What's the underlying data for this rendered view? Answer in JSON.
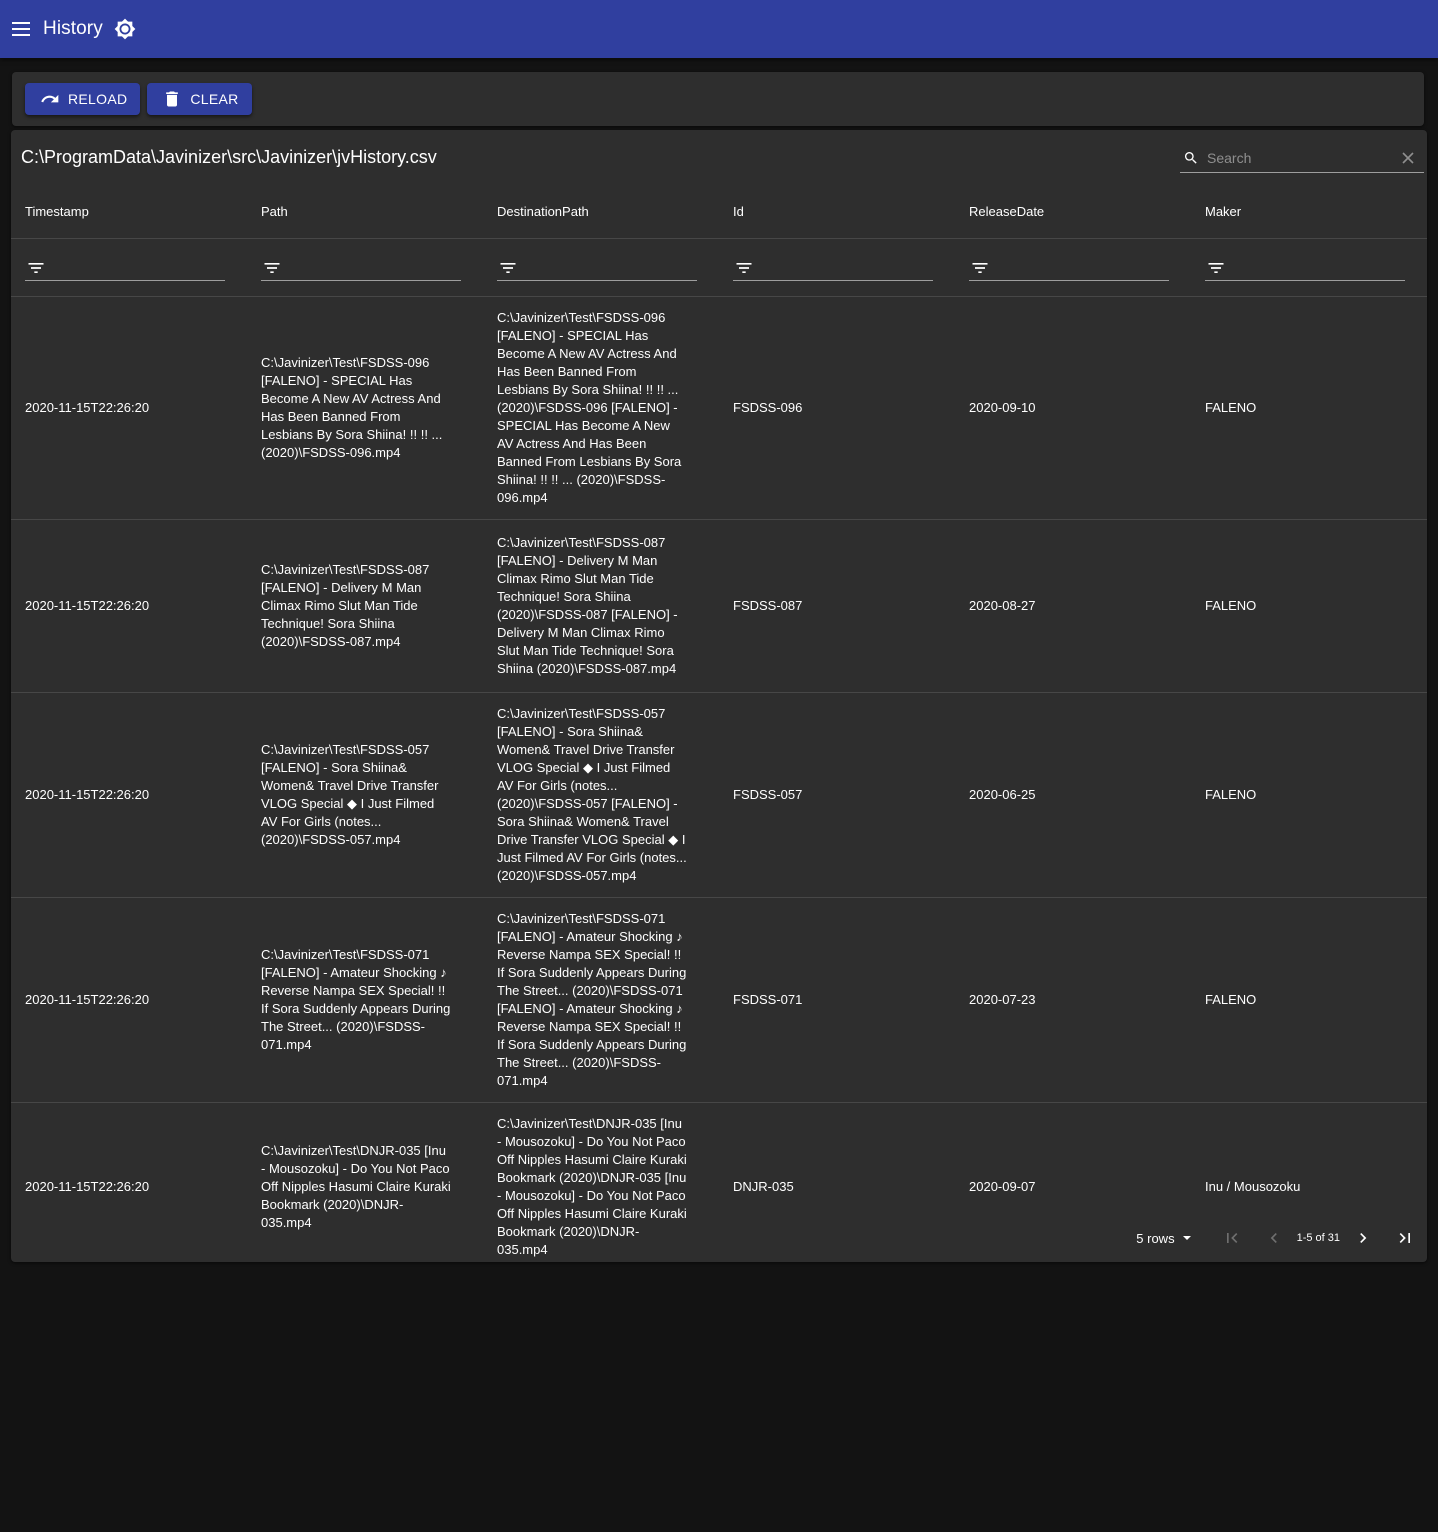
{
  "appbar": {
    "title": "History",
    "menu_icon": "menu-icon",
    "theme_icon": "brightness-icon"
  },
  "toolbar": {
    "reload_label": "RELOAD",
    "clear_label": "CLEAR"
  },
  "table": {
    "title": "C:\\ProgramData\\Javinizer\\src\\Javinizer\\jvHistory.csv",
    "search_placeholder": "Search",
    "columns": [
      "Timestamp",
      "Path",
      "DestinationPath",
      "Id",
      "ReleaseDate",
      "Maker"
    ],
    "rows": [
      {
        "timestamp": "2020-11-15T22:26:20",
        "path": "C:\\Javinizer\\Test\\FSDSS-096 [FALENO] - SPECIAL Has Become A New AV Actress And Has Been Banned From Lesbians By Sora Shiina! !! !! ... (2020)\\FSDSS-096.mp4",
        "destination": "C:\\Javinizer\\Test\\FSDSS-096 [FALENO] - SPECIAL Has Become A New AV Actress And Has Been Banned From Lesbians By Sora Shiina! !! !! ... (2020)\\FSDSS-096 [FALENO] - SPECIAL Has Become A New AV Actress And Has Been Banned From Lesbians By Sora Shiina! !! !! ... (2020)\\FSDSS-096.mp4",
        "id": "FSDSS-096",
        "release_date": "2020-09-10",
        "maker": "FALENO"
      },
      {
        "timestamp": "2020-11-15T22:26:20",
        "path": "C:\\Javinizer\\Test\\FSDSS-087 [FALENO] - Delivery M Man Climax Rimo Slut Man Tide Technique! Sora Shiina (2020)\\FSDSS-087.mp4",
        "destination": "C:\\Javinizer\\Test\\FSDSS-087 [FALENO] - Delivery M Man Climax Rimo Slut Man Tide Technique! Sora Shiina (2020)\\FSDSS-087 [FALENO] - Delivery M Man Climax Rimo Slut Man Tide Technique! Sora Shiina (2020)\\FSDSS-087.mp4",
        "id": "FSDSS-087",
        "release_date": "2020-08-27",
        "maker": "FALENO"
      },
      {
        "timestamp": "2020-11-15T22:26:20",
        "path": "C:\\Javinizer\\Test\\FSDSS-057 [FALENO] - Sora Shiina& Women& Travel Drive Transfer VLOG Special ◆ I Just Filmed AV For Girls (notes... (2020)\\FSDSS-057.mp4",
        "destination": "C:\\Javinizer\\Test\\FSDSS-057 [FALENO] - Sora Shiina& Women& Travel Drive Transfer VLOG Special ◆ I Just Filmed AV For Girls (notes... (2020)\\FSDSS-057 [FALENO] - Sora Shiina& Women& Travel Drive Transfer VLOG Special ◆ I Just Filmed AV For Girls (notes... (2020)\\FSDSS-057.mp4",
        "id": "FSDSS-057",
        "release_date": "2020-06-25",
        "maker": "FALENO"
      },
      {
        "timestamp": "2020-11-15T22:26:20",
        "path": "C:\\Javinizer\\Test\\FSDSS-071 [FALENO] - Amateur Shocking ♪ Reverse Nampa SEX Special! !! If Sora Suddenly Appears During The Street... (2020)\\FSDSS-071.mp4",
        "destination": "C:\\Javinizer\\Test\\FSDSS-071 [FALENO] - Amateur Shocking ♪ Reverse Nampa SEX Special! !! If Sora Suddenly Appears During The Street... (2020)\\FSDSS-071 [FALENO] - Amateur Shocking ♪ Reverse Nampa SEX Special! !! If Sora Suddenly Appears During The Street... (2020)\\FSDSS-071.mp4",
        "id": "FSDSS-071",
        "release_date": "2020-07-23",
        "maker": "FALENO"
      },
      {
        "timestamp": "2020-11-15T22:26:20",
        "path": "C:\\Javinizer\\Test\\DNJR-035 [Inu - Mousozoku] - Do You Not Paco Off Nipples Hasumi Claire Kuraki Bookmark (2020)\\DNJR-035.mp4",
        "destination": "C:\\Javinizer\\Test\\DNJR-035 [Inu - Mousozoku] - Do You Not Paco Off Nipples Hasumi Claire Kuraki Bookmark (2020)\\DNJR-035 [Inu - Mousozoku] - Do You Not Paco Off Nipples Hasumi Claire Kuraki Bookmark (2020)\\DNJR-035.mp4",
        "id": "DNJR-035",
        "release_date": "2020-09-07",
        "maker": "Inu / Mousozoku"
      }
    ]
  },
  "pagination": {
    "rows_per_page": "5 rows",
    "page_info": "1-5 of 31"
  },
  "colors": {
    "appbar": "#303f9f",
    "background": "#131313",
    "card": "#2e2e2e"
  }
}
